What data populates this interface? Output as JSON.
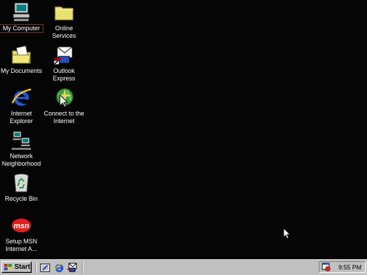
{
  "desktop": {
    "background": "#050505",
    "icons": [
      {
        "label": "My Computer",
        "icon": "my-computer-icon",
        "selected": true
      },
      {
        "label": "Online Services",
        "icon": "folder-icon"
      },
      {
        "label": "My Documents",
        "icon": "my-documents-icon"
      },
      {
        "label": "Outlook Express",
        "icon": "outlook-express-icon"
      },
      {
        "label": "Internet Explorer",
        "icon": "internet-explorer-icon"
      },
      {
        "label": "Connect to the Internet",
        "icon": "connect-internet-icon"
      },
      {
        "label": "Network Neighborhood",
        "icon": "network-neighborhood-icon"
      },
      {
        "label": "Recycle Bin",
        "icon": "recycle-bin-icon"
      },
      {
        "label": "Setup MSN Internet A...",
        "icon": "msn-icon"
      }
    ]
  },
  "taskbar": {
    "start_label": "Start",
    "quick_launch": [
      "show-desktop-icon",
      "internet-explorer-icon",
      "outlook-express-icon"
    ],
    "clock": "9:55 PM"
  }
}
